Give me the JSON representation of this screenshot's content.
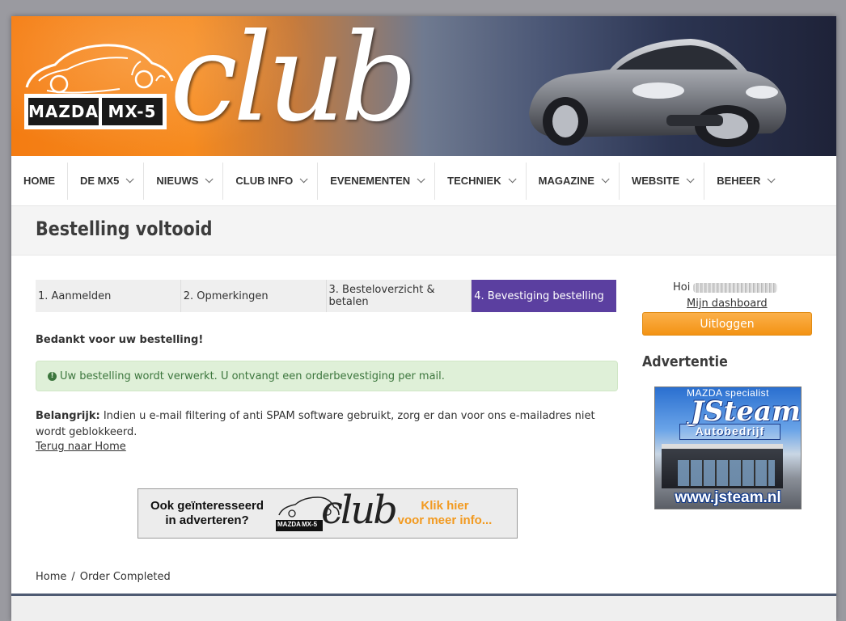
{
  "header": {
    "logo_word_1": "MAZDA",
    "logo_word_2": "MX-5",
    "logo_club": "club"
  },
  "nav": {
    "items": [
      {
        "label": "HOME"
      },
      {
        "label": "DE MX5"
      },
      {
        "label": "NIEUWS"
      },
      {
        "label": "CLUB INFO"
      },
      {
        "label": "EVENEMENTEN"
      },
      {
        "label": "TECHNIEK"
      },
      {
        "label": "MAGAZINE"
      },
      {
        "label": "WEBSITE"
      },
      {
        "label": "BEHEER"
      }
    ]
  },
  "page": {
    "title": "Bestelling voltooid"
  },
  "steps": [
    {
      "label": "1. Aanmelden"
    },
    {
      "label": "2. Opmerkingen"
    },
    {
      "label": "3. Besteloverzicht & betalen"
    },
    {
      "label": "4. Bevestiging bestelling"
    }
  ],
  "content": {
    "thanks": "Bedankt voor uw bestelling!",
    "alert": "Uw bestelling wordt verwerkt. U ontvangt een orderbevestiging per mail.",
    "important_label": "Belangrijk:",
    "important_text": " Indien u e-mail filtering of anti SPAM software gebruikt, zorg er dan voor ons e-mailadres niet wordt geblokkeerd.",
    "back_link": "Terug naar Home"
  },
  "ad_banner": {
    "left_line_1": "Ook geïnteresseerd",
    "left_line_2": "in adverteren?",
    "logo_word_1": "MAZDA",
    "logo_word_2": "MX-5",
    "logo_club": "club",
    "right_line_1": "Klik hier",
    "right_line_2": "voor meer info..."
  },
  "breadcrumb": {
    "home": "Home",
    "separator": "/",
    "current": "Order Completed"
  },
  "sidebar": {
    "greeting": "Hoi",
    "dashboard_link": "Mijn dashboard",
    "logout_button": "Uitloggen",
    "ad_title": "Advertentie",
    "ad": {
      "top": "MAZDA specialist",
      "brand": "JSteam",
      "sub": "Autobedrijf",
      "url": "www.jsteam.nl"
    }
  },
  "colors": {
    "accent_step": "#5b3fa0",
    "logout": "#f39314",
    "alert_bg": "#dff0d8",
    "alert_text": "#3c763d",
    "banner_orange": "#f47c12"
  }
}
